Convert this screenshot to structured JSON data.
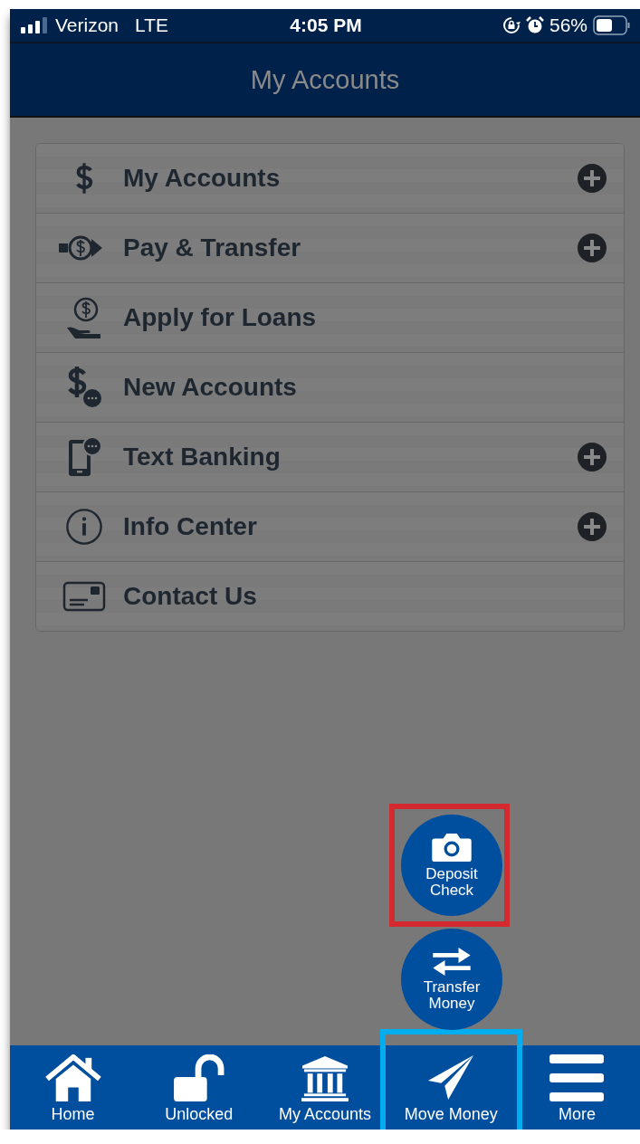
{
  "status_bar": {
    "carrier": "Verizon",
    "network": "LTE",
    "time": "4:05 PM",
    "battery": "56%"
  },
  "header": {
    "title": "My Accounts"
  },
  "menu": [
    {
      "label": "My Accounts",
      "expandable": true
    },
    {
      "label": "Pay & Transfer",
      "expandable": true
    },
    {
      "label": "Apply for Loans",
      "expandable": false
    },
    {
      "label": "New Accounts",
      "expandable": false
    },
    {
      "label": "Text Banking",
      "expandable": true
    },
    {
      "label": "Info Center",
      "expandable": true
    },
    {
      "label": "Contact Us",
      "expandable": false
    }
  ],
  "quick_actions": [
    {
      "label": "Deposit Check",
      "color": "#d42a2f"
    },
    {
      "label": "Transfer Money"
    }
  ],
  "tab_bar": [
    {
      "label": "Home"
    },
    {
      "label": "Unlocked"
    },
    {
      "label": "My Accounts"
    },
    {
      "label": "Move Money",
      "color": "#00aeef"
    },
    {
      "label": "More"
    }
  ]
}
